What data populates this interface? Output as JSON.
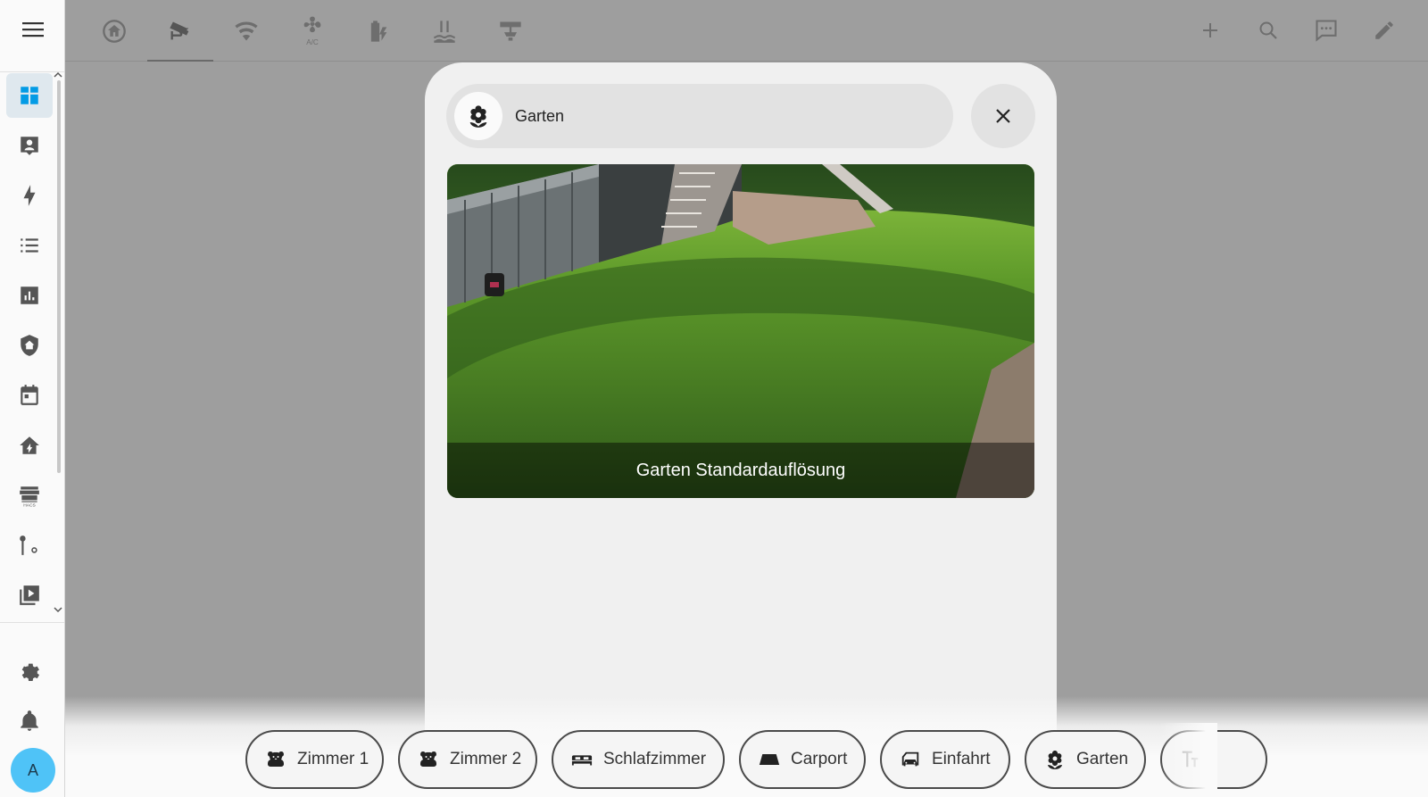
{
  "sidebar": {
    "menu_icon": "hamburger-menu-icon",
    "items": [
      {
        "id": "overview",
        "icon": "dashboard-icon",
        "active": true
      },
      {
        "id": "map",
        "icon": "account-box-icon",
        "active": false
      },
      {
        "id": "energy",
        "icon": "lightning-bolt-icon",
        "active": false
      },
      {
        "id": "logbook",
        "icon": "format-list-icon",
        "active": false
      },
      {
        "id": "history",
        "icon": "chart-box-icon",
        "active": false
      },
      {
        "id": "alarm",
        "icon": "shield-home-icon",
        "active": false
      },
      {
        "id": "calendar",
        "icon": "calendar-icon",
        "active": false
      },
      {
        "id": "home",
        "icon": "home-lightning-icon",
        "active": false
      },
      {
        "id": "hacs",
        "icon": "hacs-store-icon",
        "active": false
      },
      {
        "id": "developer-tools",
        "icon": "wrench-cog-icon",
        "active": false
      },
      {
        "id": "media",
        "icon": "play-box-multiple-icon",
        "active": false
      }
    ],
    "settings_icon": "cog-icon",
    "notifications_icon": "bell-icon",
    "avatar_initial": "A"
  },
  "topbar": {
    "tabs": [
      {
        "icon": "home-circle-icon",
        "active": false
      },
      {
        "icon": "cctv-camera-icon",
        "active": true
      },
      {
        "icon": "wifi-icon",
        "active": false
      },
      {
        "icon": "air-conditioner-icon",
        "active": false
      },
      {
        "icon": "battery-charging-icon",
        "active": false
      },
      {
        "icon": "pool-icon",
        "active": false
      },
      {
        "icon": "ceiling-light-icon",
        "active": false
      }
    ],
    "actions": [
      {
        "icon": "plus-icon"
      },
      {
        "icon": "magnify-icon"
      },
      {
        "icon": "message-icon"
      },
      {
        "icon": "pencil-icon"
      }
    ]
  },
  "dialog": {
    "title": "Garten",
    "title_icon": "flower-icon",
    "close_icon": "close-icon",
    "camera_caption": "Garten Standardauflösung"
  },
  "chips": [
    {
      "label": "Zimmer 1",
      "icon": "teddy-bear-icon"
    },
    {
      "label": "Zimmer 2",
      "icon": "teddy-bear-icon"
    },
    {
      "label": "Schlafzimmer",
      "icon": "bed-icon"
    },
    {
      "label": "Carport",
      "icon": "car-floor-icon"
    },
    {
      "label": "Einfahrt",
      "icon": "car-door-icon"
    },
    {
      "label": "Garten",
      "icon": "flower-icon"
    },
    {
      "label": "",
      "icon": "text-icon"
    }
  ]
}
